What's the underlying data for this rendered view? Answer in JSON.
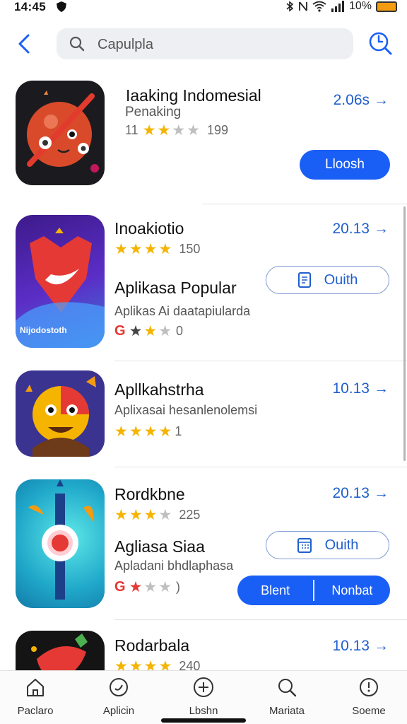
{
  "status": {
    "time": "14:45",
    "battery": "10%"
  },
  "search": {
    "query": "Capulpla"
  },
  "apps": [
    {
      "name": "Iaaking Indomesial",
      "subtitle": "Penaking",
      "size": "2.06s",
      "rating_prefix": "11",
      "rating_count": "199",
      "button": "Lloosh"
    },
    {
      "name": "Inoakiotio",
      "size": "20.13",
      "rating_count": "150",
      "icon_label": "Nijodostoth",
      "section_title": "Aplikasa Popular",
      "section_desc": "Aplikas Ai daatapiularda",
      "second_rating_count": "0",
      "button": "Ouith"
    },
    {
      "name": "Apllkahstrha",
      "size": "10.13",
      "desc": "Aplixasai hesanlenolemsi",
      "rating_count": "1"
    },
    {
      "name": "Rordkbne",
      "size": "20.13",
      "rating_count": "225",
      "section_title": "Agliasa Siaa",
      "section_desc": "Apladani bhdlaphasa",
      "second_rating_count": ")",
      "button": "Ouith",
      "split_left": "Blent",
      "split_right": "Nonbat"
    },
    {
      "name": "Rodarbala",
      "size": "10.13",
      "rating_count": "240"
    }
  ],
  "tabs": [
    {
      "label": "Paclaro",
      "icon": "home-icon"
    },
    {
      "label": "Aplicin",
      "icon": "apps-icon"
    },
    {
      "label": "Lbshn",
      "icon": "add-icon"
    },
    {
      "label": "Mariata",
      "icon": "search-icon"
    },
    {
      "label": "Soeme",
      "icon": "clock-icon"
    }
  ],
  "colors": {
    "accent": "#1a5ff5",
    "size_text": "#1f5fcc",
    "star": "#f4b400"
  }
}
